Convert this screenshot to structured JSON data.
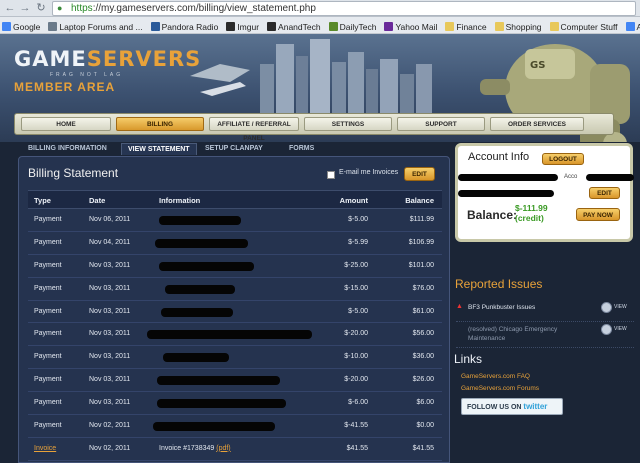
{
  "browser": {
    "url_scheme": "https",
    "url_rest": "://my.gameservers.com/billing/view_statement.php",
    "bookmarks": [
      {
        "label": "Google",
        "color": "#4285f4"
      },
      {
        "label": "Laptop Forums and ...",
        "color": "#6a7a8a"
      },
      {
        "label": "Pandora Radio",
        "color": "#2a5a9a"
      },
      {
        "label": "Imgur",
        "color": "#2a2a2a"
      },
      {
        "label": "AnandTech",
        "color": "#2a2a2a"
      },
      {
        "label": "DailyTech",
        "color": "#5a8a2a"
      },
      {
        "label": "Yahoo Mail",
        "color": "#6a2a9a"
      },
      {
        "label": "Finance",
        "color": "#e8c85a"
      },
      {
        "label": "Shopping",
        "color": "#e8c85a"
      },
      {
        "label": "Computer Stuff",
        "color": "#e8c85a"
      },
      {
        "label": "Alarm",
        "color": "#4285f4"
      }
    ]
  },
  "header": {
    "logo_main": "GAME",
    "logo_accent": "SERVERS",
    "tagline": "FRAG NOT LAG",
    "member_area": "MEMBER AREA"
  },
  "nav": {
    "items": [
      "HOME",
      "BILLING",
      "AFFILIATE / REFERRAL PANEL",
      "SETTINGS",
      "SUPPORT",
      "ORDER SERVICES"
    ],
    "active": "BILLING"
  },
  "subtabs": [
    "BILLING INFORMATION",
    "VIEW STATEMENT",
    "SETUP CLANPAY",
    "FORMS"
  ],
  "billing": {
    "title": "Billing Statement",
    "email_label": "E-mail me Invoices",
    "edit_label": "EDIT",
    "columns": [
      "Type",
      "Date",
      "Information",
      "Amount",
      "Balance"
    ],
    "rows": [
      {
        "type": "Payment",
        "date": "Nov 06, 2011",
        "info": "",
        "amount": "$-5.00",
        "balance": "$111.99"
      },
      {
        "type": "Payment",
        "date": "Nov 04, 2011",
        "info": "",
        "amount": "$-5.99",
        "balance": "$106.99"
      },
      {
        "type": "Payment",
        "date": "Nov 03, 2011",
        "info": "",
        "amount": "$-25.00",
        "balance": "$101.00"
      },
      {
        "type": "Payment",
        "date": "Nov 03, 2011",
        "info": "",
        "amount": "$-15.00",
        "balance": "$76.00"
      },
      {
        "type": "Payment",
        "date": "Nov 03, 2011",
        "info": "",
        "amount": "$-5.00",
        "balance": "$61.00"
      },
      {
        "type": "Payment",
        "date": "Nov 03, 2011",
        "info": "",
        "amount": "$-20.00",
        "balance": "$56.00"
      },
      {
        "type": "Payment",
        "date": "Nov 03, 2011",
        "info": "",
        "amount": "$-10.00",
        "balance": "$36.00"
      },
      {
        "type": "Payment",
        "date": "Nov 03, 2011",
        "info": "",
        "amount": "$-20.00",
        "balance": "$26.00"
      },
      {
        "type": "Payment",
        "date": "Nov 03, 2011",
        "info": "",
        "amount": "$-6.00",
        "balance": "$6.00"
      },
      {
        "type": "Payment",
        "date": "Nov 02, 2011",
        "info": "",
        "amount": "$-41.55",
        "balance": "$0.00"
      },
      {
        "type": "Invoice",
        "date": "Nov 02, 2011",
        "info": "Invoice #1738349",
        "pdf": "(pdf)",
        "amount": "$41.55",
        "balance": "$41.55"
      }
    ]
  },
  "account": {
    "title": "Account Info",
    "logout": "LOGOUT",
    "acc_label": "Acco",
    "edit": "EDIT",
    "balance_label": "Balance:",
    "balance_value": "$-111.99",
    "balance_note": "(credit)",
    "pay_now": "PAY NOW"
  },
  "issues": {
    "title": "Reported Issues",
    "items": [
      {
        "text": "BF3 Punkbuster Issues",
        "view": "VIEW"
      },
      {
        "text": "(resolved) Chicago Emergency Maintenance",
        "view": "VIEW"
      }
    ]
  },
  "links": {
    "title": "Links",
    "items": [
      "GameServers.com FAQ",
      "GameServers.com Forums"
    ],
    "follow_label": "FOLLOW US ON",
    "follow_brand": "twitter"
  }
}
